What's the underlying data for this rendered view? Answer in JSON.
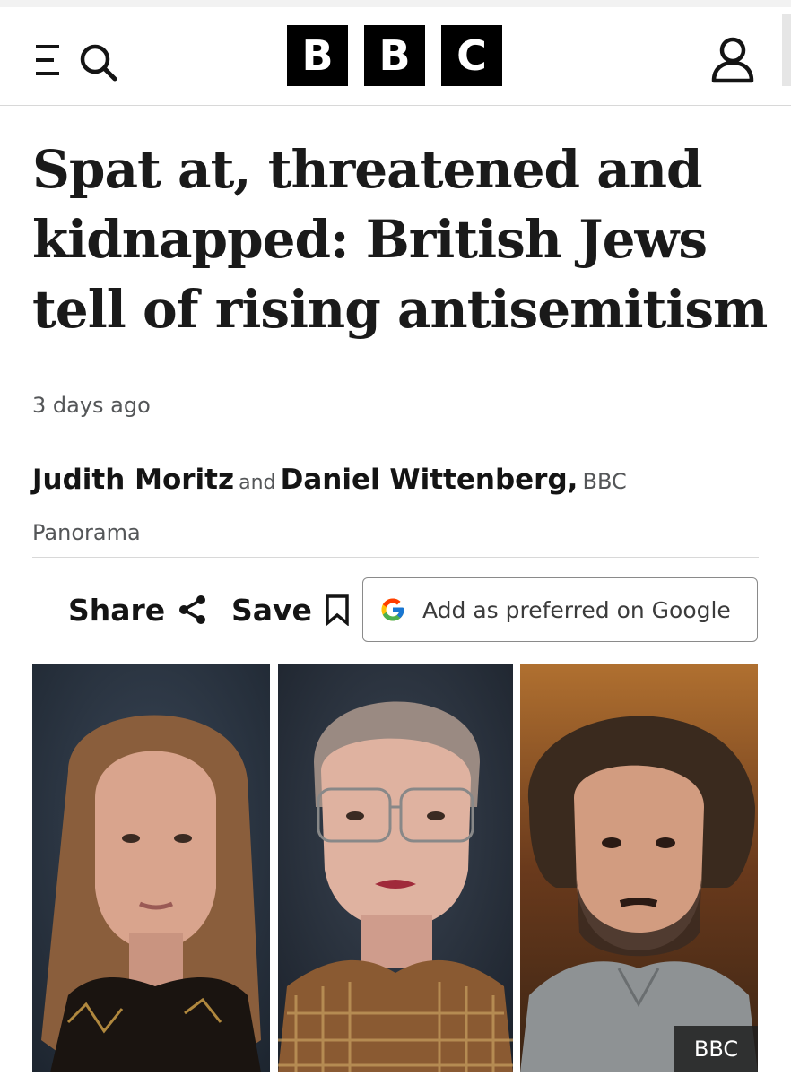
{
  "header": {
    "logo_letters": [
      "B",
      "B",
      "C"
    ],
    "menu_icon": "menu-icon",
    "search_icon": "search-icon",
    "account_icon": "account-icon"
  },
  "article": {
    "headline": "Spat at, threatened and kidnapped: British Jews tell of rising antisemitism",
    "timestamp": "3 days ago",
    "byline": {
      "author1": "Judith Moritz",
      "conjunction": "and",
      "author2": "Daniel Wittenberg,",
      "organisation": "BBC Panorama"
    }
  },
  "actions": {
    "share_label": "Share",
    "save_label": "Save",
    "google_label": "Add as preferred on Google"
  },
  "image": {
    "credit": "BBC"
  },
  "colors": {
    "logo": "#000000",
    "text": "#141414",
    "muted": "#545658"
  }
}
